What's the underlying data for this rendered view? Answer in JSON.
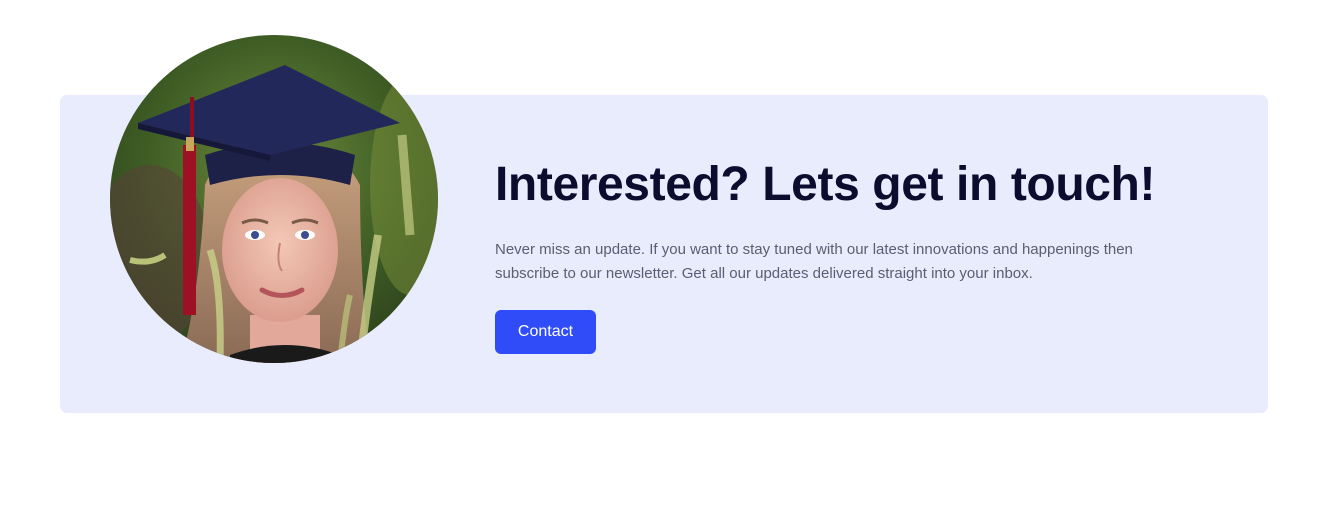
{
  "cta": {
    "headline": "Interested? Lets get in touch!",
    "description": "Never miss an update. If you want to stay tuned with our latest innovations and happenings then subscribe to our newsletter. Get all our updates delivered straight into your inbox.",
    "button_label": "Contact"
  },
  "photo": {
    "alt": "graduate-portrait",
    "subject": "graduate wearing cap and red tassel"
  },
  "colors": {
    "card_bg": "#e9ecfd",
    "headline": "#0d0c2e",
    "body_text": "#5c5d70",
    "button_bg": "#2f4cf8",
    "button_text": "#ffffff"
  }
}
